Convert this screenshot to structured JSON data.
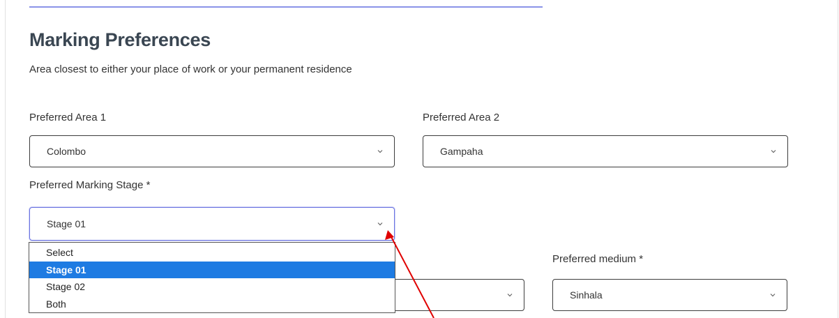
{
  "form": {
    "title": "Marking Preferences",
    "subtitle": "Area closest to either your place of work or your permanent residence",
    "preferred_area_1": {
      "label": "Preferred Area 1",
      "value": "Colombo"
    },
    "preferred_area_2": {
      "label": "Preferred Area 2",
      "value": "Gampaha"
    },
    "marking_stage": {
      "label": "Preferred Marking Stage *",
      "value": "Stage 01",
      "options": [
        "Select",
        "Stage 01",
        "Stage 02",
        "Both"
      ],
      "selected_index": 1
    },
    "hidden_select": {
      "value": ""
    },
    "preferred_medium": {
      "label": "Preferred medium *",
      "value": "Sinhala"
    }
  },
  "colors": {
    "accent": "#1e7be2",
    "focus_border": "#6b74e0",
    "annotation_arrow": "#e00000"
  }
}
